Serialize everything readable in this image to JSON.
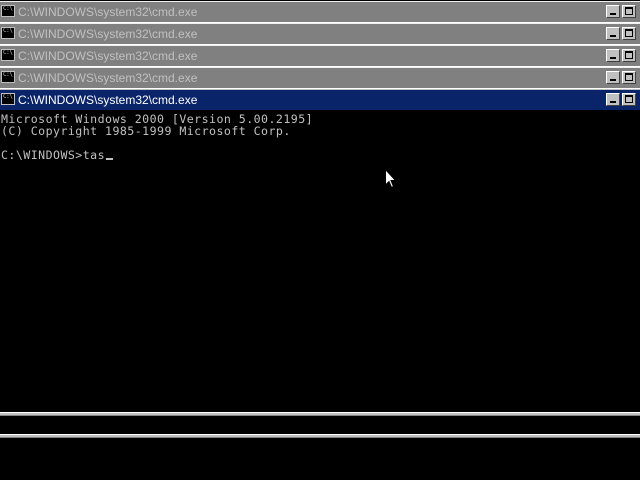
{
  "windows": [
    {
      "title": "C:\\WINDOWS\\system32\\cmd.exe",
      "active": false
    },
    {
      "title": "C:\\WINDOWS\\system32\\cmd.exe",
      "active": false
    },
    {
      "title": "C:\\WINDOWS\\system32\\cmd.exe",
      "active": false
    },
    {
      "title": "C:\\WINDOWS\\system32\\cmd.exe",
      "active": false
    },
    {
      "title": "C:\\WINDOWS\\system32\\cmd.exe",
      "active": true
    }
  ],
  "app_icon_text": "C:\\",
  "console": {
    "line1": "Microsoft Windows 2000 [Version 5.00.2195]",
    "line2": "(C) Copyright 1985-1999 Microsoft Corp.",
    "prompt": "C:\\WINDOWS>",
    "typed": "tas"
  },
  "colors": {
    "active_title": "#0a246a",
    "inactive_title": "#808080",
    "console_bg": "#000000",
    "console_fg": "#c0c0c0"
  },
  "icons": {
    "app": "cmd-icon",
    "minimize": "minimize-icon",
    "maximize": "maximize-icon",
    "pointer": "mouse-pointer-icon"
  }
}
